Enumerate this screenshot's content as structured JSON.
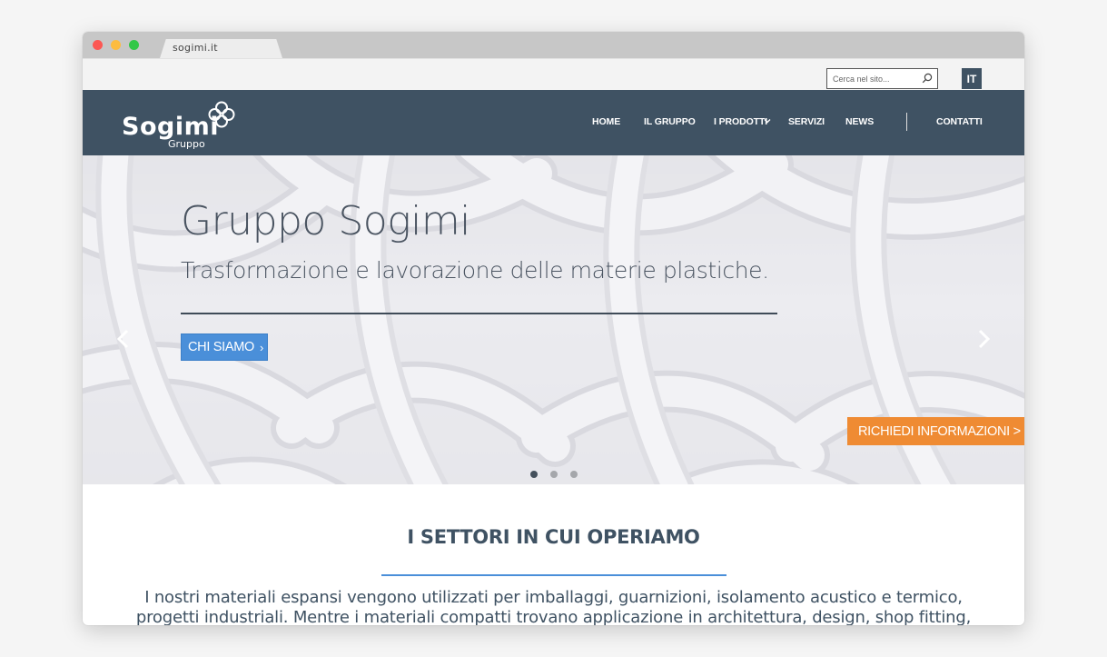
{
  "browser": {
    "tab_title": "sogimi.it"
  },
  "topbar": {
    "search_placeholder": "Cerca nel sito...",
    "language": "IT"
  },
  "header": {
    "logo_name": "Sogimi",
    "logo_sub": "Gruppo",
    "nav": [
      {
        "label": "HOME"
      },
      {
        "label": "IL GRUPPO"
      },
      {
        "label": "I PRODOTTI"
      },
      {
        "label": "SERVIZI"
      },
      {
        "label": "NEWS"
      },
      {
        "label": "CONTATTI"
      }
    ]
  },
  "hero": {
    "title": "Gruppo Sogimi",
    "subtitle": "Trasformazione e lavorazione delle materie plastiche.",
    "button_label": "CHI SIAMO",
    "button_arrow": "›",
    "cta_label": "RICHIEDI INFORMAZIONI >",
    "slides_total": 3,
    "slide_active": 1
  },
  "section": {
    "title": "I SETTORI IN CUI OPERIAMO",
    "text": "I nostri materiali espansi vengono utilizzati per imballaggi, guarnizioni, isolamento acustico e termico, progetti industriali. Mentre i materiali compatti trovano applicazione in architettura, design, shop fitting, allestimento"
  },
  "colors": {
    "navbar": "#3f5263",
    "accent_blue": "#4a8fd9",
    "accent_orange": "#ef8b33"
  },
  "icons": [
    "search-icon",
    "logo-knot-icon",
    "chevron-down-icon",
    "chevron-left-icon",
    "chevron-right-icon"
  ]
}
